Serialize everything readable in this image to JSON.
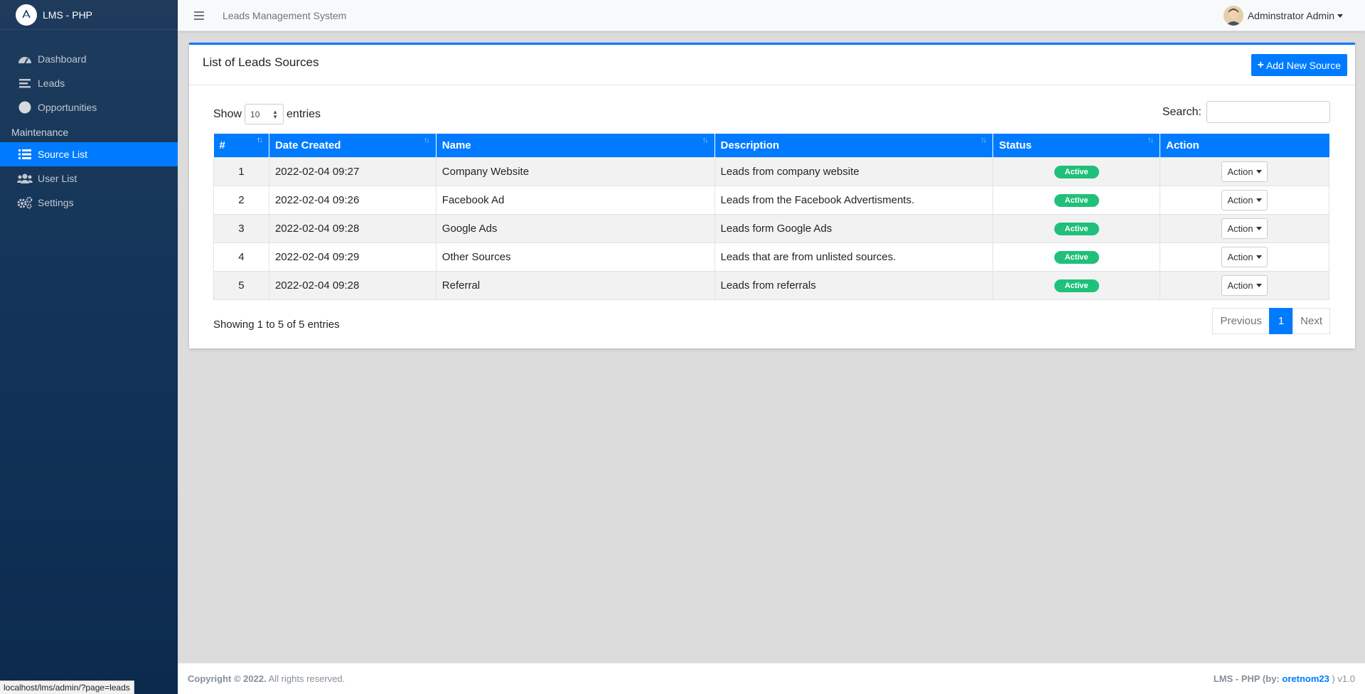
{
  "app": {
    "brand": "LMS - PHP",
    "system_title": "Leads Management System"
  },
  "sidebar": {
    "items": [
      {
        "label": "Dashboard",
        "icon": "dashboard-icon"
      },
      {
        "label": "Leads",
        "icon": "list-icon"
      },
      {
        "label": "Opportunities",
        "icon": "circle-icon"
      }
    ],
    "section_header": "Maintenance",
    "maintenance_items": [
      {
        "label": "Source List",
        "icon": "list-ul-icon",
        "active": true
      },
      {
        "label": "User List",
        "icon": "users-icon"
      },
      {
        "label": "Settings",
        "icon": "gears-icon"
      }
    ]
  },
  "user": {
    "name": "Adminstrator Admin"
  },
  "card": {
    "title": "List of Leads Sources",
    "add_button": "Add New Source"
  },
  "datatable": {
    "show_label": "Show",
    "entries_label": "entries",
    "page_length": "10",
    "search_label": "Search:",
    "columns": [
      "#",
      "Date Created",
      "Name",
      "Description",
      "Status",
      "Action"
    ],
    "rows": [
      {
        "num": "1",
        "date": "2022-02-04 09:27",
        "name": "Company Website",
        "description": "Leads from company website",
        "status": "Active",
        "action": "Action"
      },
      {
        "num": "2",
        "date": "2022-02-04 09:26",
        "name": "Facebook Ad",
        "description": "Leads from the Facebook Advertisments.",
        "status": "Active",
        "action": "Action"
      },
      {
        "num": "3",
        "date": "2022-02-04 09:28",
        "name": "Google Ads",
        "description": "Leads form Google Ads",
        "status": "Active",
        "action": "Action"
      },
      {
        "num": "4",
        "date": "2022-02-04 09:29",
        "name": "Other Sources",
        "description": "Leads that are from unlisted sources.",
        "status": "Active",
        "action": "Action"
      },
      {
        "num": "5",
        "date": "2022-02-04 09:28",
        "name": "Referral",
        "description": "Leads from referrals",
        "status": "Active",
        "action": "Action"
      }
    ],
    "info": "Showing 1 to 5 of 5 entries",
    "pagination": {
      "previous": "Previous",
      "current": "1",
      "next": "Next"
    }
  },
  "footer": {
    "copyright": "Copyright © 2022.",
    "rights": "All rights reserved.",
    "credit_prefix": "LMS - PHP (by:",
    "credit_author": "oretnom23",
    "credit_suffix": ") v1.0"
  },
  "status_bar_url": "localhost/lms/admin/?page=leads",
  "colors": {
    "primary": "#007bff",
    "sidebar": "#14355a",
    "badge": "#20c07a"
  }
}
